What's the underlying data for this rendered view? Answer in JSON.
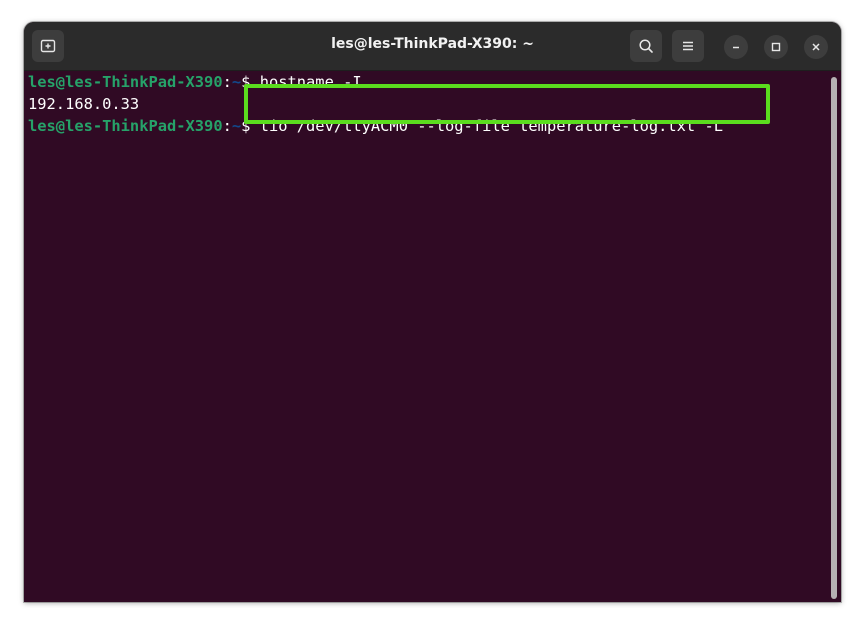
{
  "window": {
    "title": "les@les-ThinkPad-X390: ~"
  },
  "terminal": {
    "lines": [
      {
        "user": "les@les-ThinkPad-X390",
        "sep": ":",
        "path": "~",
        "symbol": "$ ",
        "command": "hostname -I"
      },
      {
        "output": "192.168.0.33"
      },
      {
        "user": "les@les-ThinkPad-X390",
        "sep": ":",
        "path": "~",
        "symbol": "$ ",
        "command": "tio /dev/ttyACM0 --log-file temperature-log.txt -L"
      }
    ]
  },
  "colors": {
    "background": "#300a24",
    "prompt_user": "#26a269",
    "prompt_path": "#12488b",
    "highlight": "#5bdc1e"
  },
  "icons": {
    "new_tab": "new-tab-icon",
    "search": "search-icon",
    "menu": "hamburger-menu-icon",
    "minimize": "minimize-icon",
    "maximize": "maximize-icon",
    "close": "close-icon"
  }
}
